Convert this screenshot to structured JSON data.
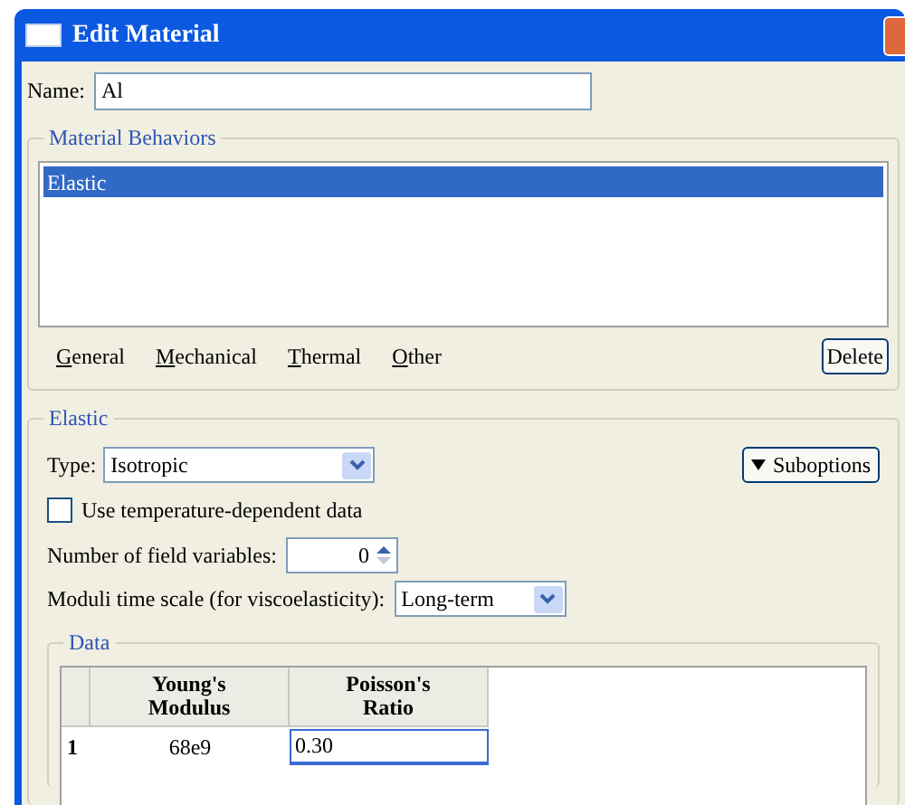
{
  "window": {
    "title": "Edit Material"
  },
  "name_field": {
    "label": "Name:",
    "value": "Al"
  },
  "material_behaviors": {
    "title": "Material Behaviors",
    "items": [
      {
        "label": "Elastic",
        "selected": true
      }
    ]
  },
  "menus": [
    "General",
    "Mechanical",
    "Thermal",
    "Other"
  ],
  "delete_button": "Delete",
  "elastic": {
    "title": "Elastic",
    "type_label": "Type:",
    "type_value": "Isotropic",
    "suboptions": "Suboptions",
    "temperature_dependent": {
      "label": "Use temperature-dependent data",
      "checked": false
    },
    "field_variables": {
      "label": "Number of field variables:",
      "value": "0"
    },
    "time_scale": {
      "label": "Moduli time scale (for viscoelasticity):",
      "value": "Long-term"
    }
  },
  "data": {
    "title": "Data",
    "columns": [
      "Young's Modulus",
      "Poisson's Ratio"
    ],
    "rows": [
      {
        "index": "1",
        "cells": [
          "68e9",
          "0.30"
        ],
        "editing": true
      }
    ]
  }
}
